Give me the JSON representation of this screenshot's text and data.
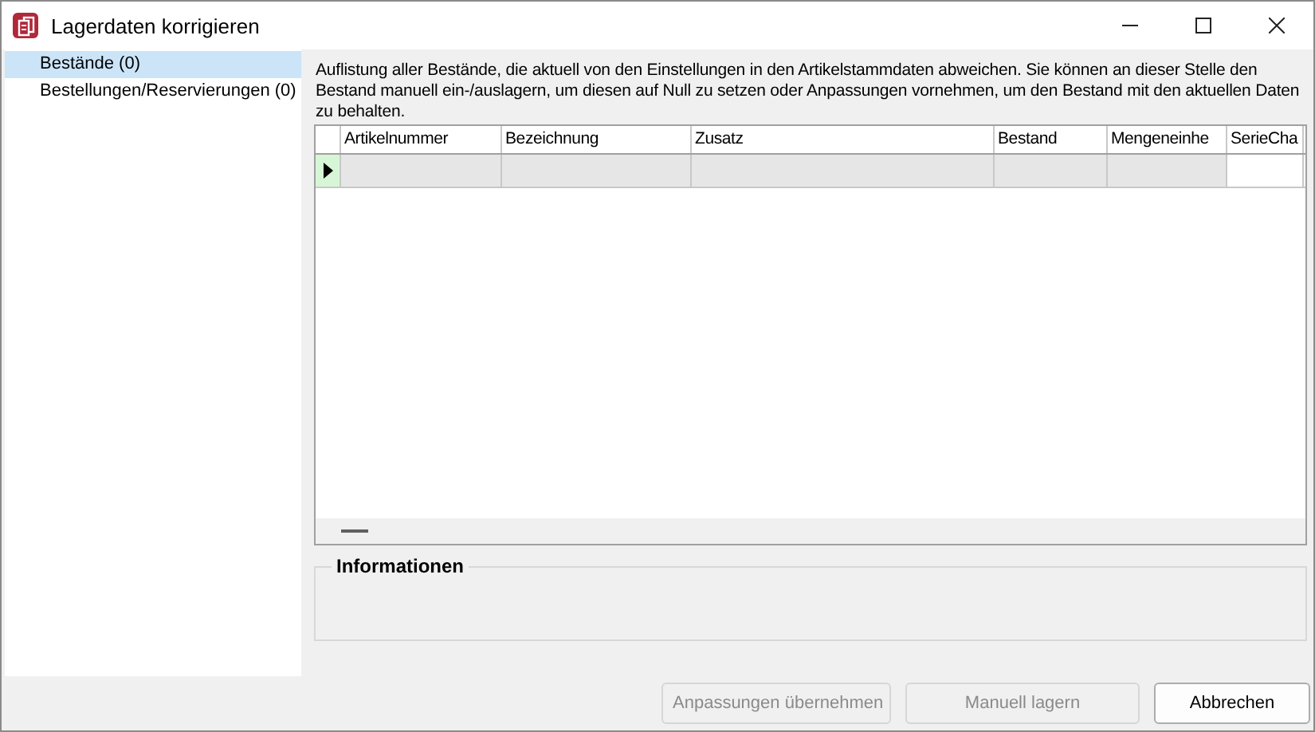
{
  "window": {
    "title": "Lagerdaten korrigieren"
  },
  "sidebar": {
    "items": [
      {
        "label": "Bestände (0)",
        "selected": true
      },
      {
        "label": "Bestellungen/Reservierungen (0)",
        "selected": false
      }
    ]
  },
  "description": "Auflistung aller Bestände, die aktuell von den Einstellungen in den Artikelstammdaten abweichen. Sie können an dieser Stelle den Bestand manuell ein-/auslagern, um diesen auf Null zu setzen oder Anpassungen vornehmen, um den Bestand mit den aktuellen Daten zu behalten.",
  "table": {
    "columns": [
      "Artikelnummer",
      "Bezeichnung",
      "Zusatz",
      "Bestand",
      "Mengeneinhe",
      "SerieCha"
    ]
  },
  "info_group": {
    "title": "Informationen"
  },
  "buttons": [
    {
      "label": "Anpassungen übernehmen",
      "disabled": true
    },
    {
      "label": "Manuell lagern",
      "disabled": true
    },
    {
      "label": "Abbrechen",
      "disabled": false
    }
  ]
}
